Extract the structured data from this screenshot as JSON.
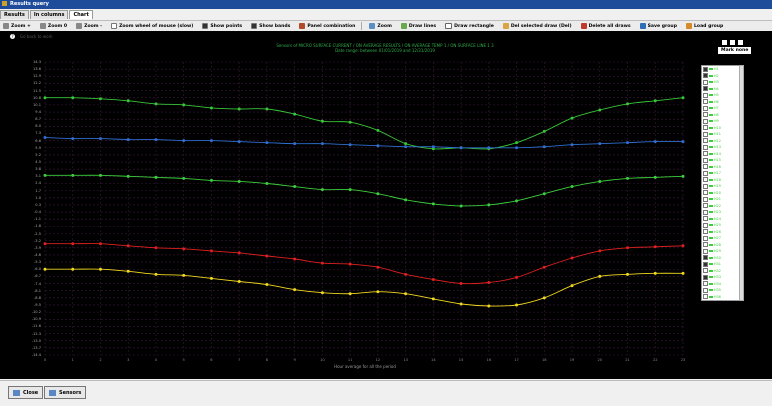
{
  "window": {
    "title": "Results query"
  },
  "tabs": [
    {
      "label": "Results",
      "active": false
    },
    {
      "label": "In columns",
      "active": false
    },
    {
      "label": "Chart",
      "active": true
    }
  ],
  "toolbar": {
    "zoom_plus": "Zoom +",
    "zoom_default": "Zoom 0",
    "zoom_minus": "Zoom -",
    "zoom_wheel": "Zoom wheel of mouse (slow)",
    "show_points": "Show points",
    "show_bands": "Show bands",
    "panel_combination": "Panel combination",
    "zoom": "Zoom",
    "draw_lines": "Draw lines",
    "draw_rectangle": "Draw rectangle",
    "del_selected": "Del selected draw (Del)",
    "delete_all": "Delete all draws",
    "save_group": "Save group",
    "load_group": "Load group"
  },
  "chart": {
    "help_text": "Go back to work",
    "title_line1": "Sensors of MICRO SURFACE CURRENT / ON AVERAGE RESULTS / ON AVERAGE TEMP 1 / ON SURFACE LINE 1 3",
    "title_line2": "Date range: between 01/01/2019 and 12/31/2019",
    "mark_none": "Mark none",
    "x_axis_label": "Hour average for all the period",
    "y_ticks": [
      "14.3",
      "13.6",
      "12.9",
      "12.2",
      "11.5",
      "10.8",
      "10.1",
      "9.4",
      "8.7",
      "8.0",
      "7.3",
      "6.6",
      "5.9",
      "5.2",
      "4.5",
      "3.8",
      "3.1",
      "2.4",
      "1.7",
      "1.0",
      "0.3",
      "-0.4",
      "-1.1",
      "-1.8",
      "-2.5",
      "-3.2",
      "-3.9",
      "-4.6",
      "-5.3",
      "-6.0",
      "-6.7",
      "-7.4",
      "-8.1",
      "-8.8",
      "-9.5",
      "-10.2",
      "-10.9",
      "-11.6",
      "-12.3",
      "-13.0",
      "-13.7",
      "-14.4"
    ],
    "x_ticks": [
      "0",
      "1",
      "2",
      "3",
      "4",
      "5",
      "6",
      "7",
      "8",
      "9",
      "10",
      "11",
      "12",
      "13",
      "14",
      "15",
      "16",
      "17",
      "18",
      "19",
      "20",
      "21",
      "22",
      "23"
    ],
    "legend_items": [
      {
        "label": "H1",
        "color": "#3ccf3c",
        "checked": true
      },
      {
        "label": "H2",
        "color": "#3ccf3c",
        "checked": true
      },
      {
        "label": "H3",
        "color": "#3ccf3c",
        "checked": false
      },
      {
        "label": "H4",
        "color": "#3ccf3c",
        "checked": true
      },
      {
        "label": "H5",
        "color": "#3ccf3c",
        "checked": false
      },
      {
        "label": "H6",
        "color": "#3ccf3c",
        "checked": false
      },
      {
        "label": "H7",
        "color": "#3ccf3c",
        "checked": false
      },
      {
        "label": "H8",
        "color": "#3ccf3c",
        "checked": false
      },
      {
        "label": "H9",
        "color": "#3ccf3c",
        "checked": false
      },
      {
        "label": "H10",
        "color": "#3ccf3c",
        "checked": false
      },
      {
        "label": "H11",
        "color": "#3ccf3c",
        "checked": false
      },
      {
        "label": "H12",
        "color": "#3ccf3c",
        "checked": false
      },
      {
        "label": "H13",
        "color": "#3ccf3c",
        "checked": false
      },
      {
        "label": "H14",
        "color": "#3ccf3c",
        "checked": false
      },
      {
        "label": "H15",
        "color": "#3ccf3c",
        "checked": false
      },
      {
        "label": "H16",
        "color": "#3ccf3c",
        "checked": false
      },
      {
        "label": "H17",
        "color": "#3ccf3c",
        "checked": false
      },
      {
        "label": "H18",
        "color": "#3ccf3c",
        "checked": false
      },
      {
        "label": "H19",
        "color": "#3ccf3c",
        "checked": false
      },
      {
        "label": "H20",
        "color": "#3ccf3c",
        "checked": false
      },
      {
        "label": "H21",
        "color": "#3ccf3c",
        "checked": false
      },
      {
        "label": "H22",
        "color": "#3ccf3c",
        "checked": false
      },
      {
        "label": "H23",
        "color": "#3ccf3c",
        "checked": false
      },
      {
        "label": "H24",
        "color": "#3ccf3c",
        "checked": false
      },
      {
        "label": "H25",
        "color": "#3ccf3c",
        "checked": false
      },
      {
        "label": "H26",
        "color": "#3ccf3c",
        "checked": false
      },
      {
        "label": "H27",
        "color": "#3ccf3c",
        "checked": false
      },
      {
        "label": "H28",
        "color": "#3ccf3c",
        "checked": false
      },
      {
        "label": "H29",
        "color": "#3ccf3c",
        "checked": false
      },
      {
        "label": "H30",
        "color": "#3ccf3c",
        "checked": true
      },
      {
        "label": "H31",
        "color": "#3ccf3c",
        "checked": true
      },
      {
        "label": "H32",
        "color": "#3ccf3c",
        "checked": false
      },
      {
        "label": "H33",
        "color": "#3ccf3c",
        "checked": true
      },
      {
        "label": "H34",
        "color": "#3ccf3c",
        "checked": false
      },
      {
        "label": "H35",
        "color": "#3ccf3c",
        "checked": false
      },
      {
        "label": "H36",
        "color": "#3ccf3c",
        "checked": false
      }
    ]
  },
  "chart_data": {
    "type": "line",
    "title": "Sensors of MICRO SURFACE CURRENT / ON AVERAGE RESULTS / ON AVERAGE TEMP 1 / ON SURFACE LINE 1 3",
    "subtitle": "Date range: between 01/01/2019 and 12/31/2019",
    "xlabel": "Hour average for all the period",
    "ylabel": "",
    "x": [
      0,
      1,
      2,
      3,
      4,
      5,
      6,
      7,
      8,
      9,
      10,
      11,
      12,
      13,
      14,
      15,
      16,
      17,
      18,
      19,
      20,
      21,
      22,
      23
    ],
    "ylim": [
      -14.4,
      14.3
    ],
    "grid": true,
    "legend": "right",
    "series": [
      {
        "color": "#37c737",
        "values": [
          10.8,
          10.8,
          10.7,
          10.5,
          10.2,
          10.1,
          9.8,
          9.7,
          9.7,
          9.2,
          8.5,
          8.4,
          7.6,
          6.3,
          5.8,
          5.9,
          5.8,
          6.4,
          7.5,
          8.8,
          9.6,
          10.2,
          10.5,
          10.8
        ]
      },
      {
        "color": "#2f6fd0",
        "values": [
          6.9,
          6.8,
          6.8,
          6.7,
          6.7,
          6.6,
          6.6,
          6.5,
          6.4,
          6.3,
          6.3,
          6.2,
          6.1,
          6.0,
          6.0,
          5.9,
          5.9,
          5.9,
          6.0,
          6.2,
          6.3,
          6.4,
          6.5,
          6.5
        ]
      },
      {
        "color": "#3ccf3c",
        "values": [
          3.2,
          3.2,
          3.2,
          3.1,
          3.0,
          2.9,
          2.7,
          2.6,
          2.4,
          2.1,
          1.8,
          1.8,
          1.4,
          0.8,
          0.4,
          0.2,
          0.3,
          0.7,
          1.4,
          2.1,
          2.6,
          2.9,
          3.0,
          3.1
        ]
      },
      {
        "color": "#e02020",
        "values": [
          -3.5,
          -3.5,
          -3.5,
          -3.7,
          -3.9,
          -4.0,
          -4.2,
          -4.4,
          -4.7,
          -5.0,
          -5.4,
          -5.5,
          -5.8,
          -6.5,
          -7.0,
          -7.4,
          -7.3,
          -6.8,
          -5.8,
          -4.9,
          -4.2,
          -3.9,
          -3.8,
          -3.7
        ]
      },
      {
        "color": "#f0d820",
        "values": [
          -6.0,
          -6.0,
          -6.0,
          -6.2,
          -6.5,
          -6.6,
          -6.9,
          -7.2,
          -7.5,
          -8.0,
          -8.3,
          -8.4,
          -8.2,
          -8.4,
          -8.9,
          -9.4,
          -9.6,
          -9.5,
          -8.8,
          -7.6,
          -6.7,
          -6.5,
          -6.4,
          -6.4
        ]
      }
    ]
  },
  "buttons": {
    "close": "Close",
    "sensors": "Sensors"
  }
}
